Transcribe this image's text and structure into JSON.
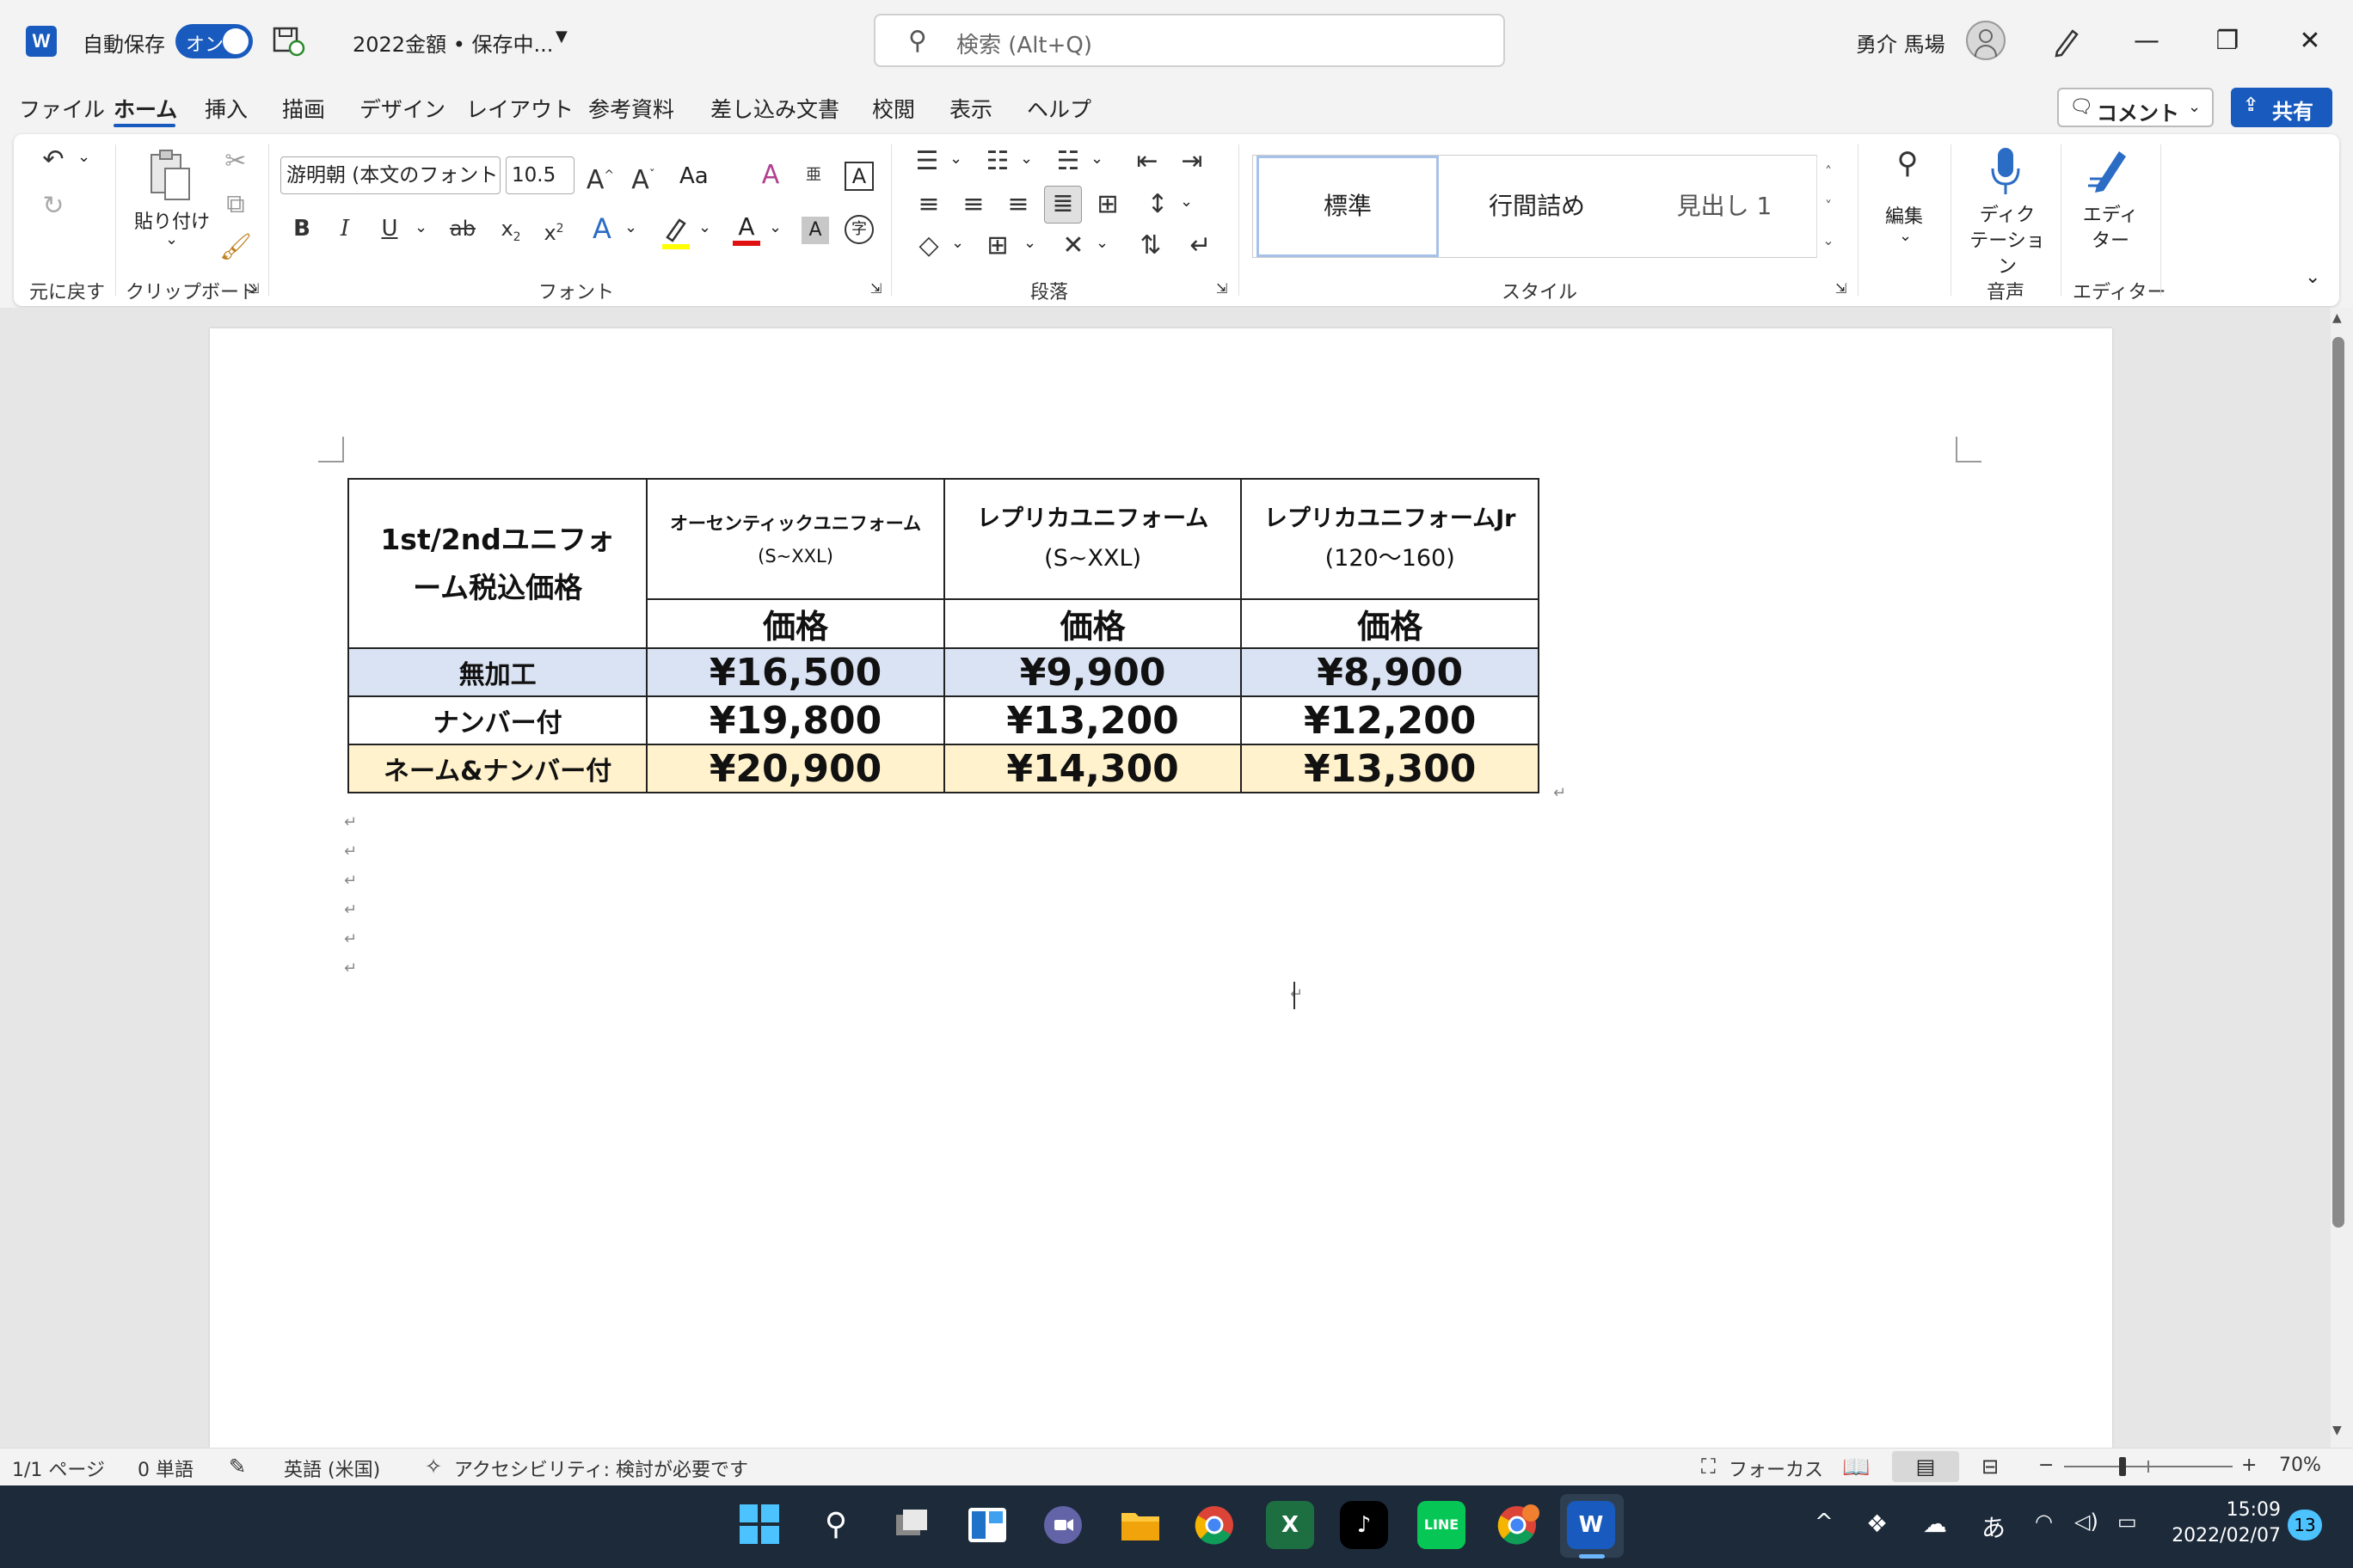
{
  "titlebar": {
    "autosave_label": "自動保存",
    "autosave_state": "オン",
    "doc_title": "2022金額 • 保存中...",
    "search_placeholder": "検索 (Alt+Q)",
    "user_name": "勇介 馬場"
  },
  "menu": {
    "tabs": [
      "ファイル",
      "ホーム",
      "挿入",
      "描画",
      "デザイン",
      "レイアウト",
      "参考資料",
      "差し込み文書",
      "校閲",
      "表示",
      "ヘルプ"
    ],
    "active": "ホーム",
    "comment_label": "コメント",
    "share_label": "共有"
  },
  "ribbon": {
    "undo_group": "元に戻す",
    "clipboard": {
      "paste_label": "貼り付け",
      "group": "クリップボード"
    },
    "font": {
      "name": "游明朝 (本文のフォント",
      "size": "10.5",
      "case_label": "Aa",
      "group": "フォント"
    },
    "paragraph": {
      "group": "段落"
    },
    "styles": {
      "items": [
        "標準",
        "行間詰め",
        "見出し 1"
      ],
      "selected": "標準",
      "group": "スタイル"
    },
    "editing": {
      "label": "編集"
    },
    "voice": {
      "label": "ディク\nテーション",
      "group": "音声"
    },
    "editor": {
      "label": "エディ\nター",
      "group": "エディター"
    }
  },
  "table": {
    "header_title": "1st/2ndユニフォーム税込価格",
    "columns": [
      {
        "name": "オーセンティックユニフォーム",
        "sub": "(S~XXL)"
      },
      {
        "name": "レプリカユニフォーム",
        "sub": "(S~XXL)"
      },
      {
        "name": "レプリカユニフォームJr",
        "sub": "(120〜160)"
      }
    ],
    "price_label": "価格",
    "rows": [
      {
        "label": "無加工",
        "values": [
          "¥16,500",
          "¥9,900",
          "¥8,900"
        ],
        "bg": "#dae3f3"
      },
      {
        "label": "ナンバー付",
        "values": [
          "¥19,800",
          "¥13,200",
          "¥12,200"
        ],
        "bg": "#ffffff"
      },
      {
        "label": "ネーム&ナンバー付",
        "values": [
          "¥20,900",
          "¥14,300",
          "¥13,300"
        ],
        "bg": "#fff2cc"
      }
    ]
  },
  "statusbar": {
    "page": "1/1 ページ",
    "words": "0 単語",
    "language": "英語 (米国)",
    "accessibility": "アクセシビリティ: 検討が必要です",
    "focus": "フォーカス",
    "zoom": "70%"
  },
  "taskbar": {
    "time": "15:09",
    "date": "2022/02/07",
    "notifications": "13",
    "ime": "あ"
  },
  "colors": {
    "accent": "#185abd",
    "row1": "#dae3f3",
    "row3": "#fff2cc"
  }
}
